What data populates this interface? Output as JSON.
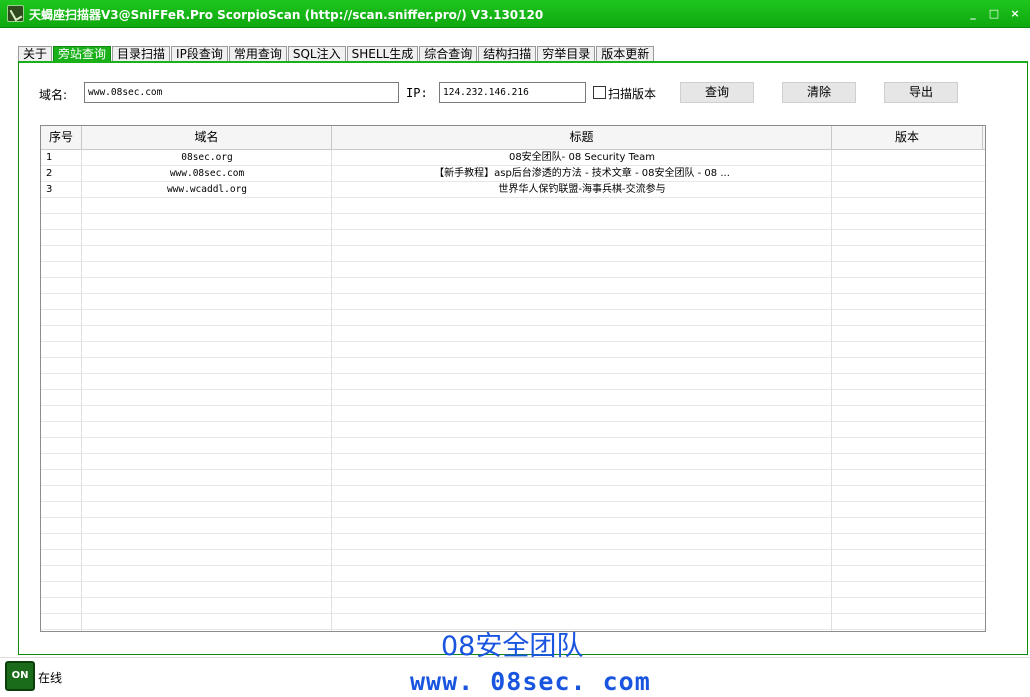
{
  "window": {
    "title": "天蝎座扫描器V3@SniFFeR.Pro  ScorpioScan (http://scan.sniffer.pro/) V3.130120",
    "controls": [
      "_",
      "□",
      "×"
    ]
  },
  "tabs": [
    {
      "label": "关于",
      "active": false
    },
    {
      "label": "旁站查询",
      "active": true
    },
    {
      "label": "目录扫描",
      "active": false
    },
    {
      "label": "IP段查询",
      "active": false
    },
    {
      "label": "常用查询",
      "active": false
    },
    {
      "label": "SQL注入",
      "active": false
    },
    {
      "label": "SHELL生成",
      "active": false
    },
    {
      "label": "综合查询",
      "active": false
    },
    {
      "label": "结构扫描",
      "active": false
    },
    {
      "label": "穷举目录",
      "active": false
    },
    {
      "label": "版本更新",
      "active": false
    }
  ],
  "query": {
    "domain_label": "域名:",
    "domain_value": "www.08sec.com",
    "ip_label": "IP:",
    "ip_value": "124.232.146.216",
    "scan_version_label": "扫描版本",
    "scan_version_checked": false,
    "query_button": "查询",
    "clear_button": "清除",
    "export_button": "导出"
  },
  "table": {
    "columns": [
      "序号",
      "域名",
      "标题",
      "版本"
    ],
    "rows": [
      {
        "index": "1",
        "domain": "08sec.org",
        "title": "08安全团队- 08 Security Team",
        "version": ""
      },
      {
        "index": "2",
        "domain": "www.08sec.com",
        "title": "【新手教程】asp后台渗透的方法 - 技术文章 - 08安全团队 - 08 ...",
        "version": ""
      },
      {
        "index": "3",
        "domain": "www.wcaddl.org",
        "title": "世界华人保钓联盟-海事兵棋-交流参与",
        "version": ""
      }
    ]
  },
  "status": {
    "icon_text": "ON",
    "text": "在线"
  },
  "watermark": {
    "line1": "08安全团队",
    "line2": "www. 08sec. com"
  },
  "colors": {
    "titlebar": "#14b814",
    "active_tab": "#19b019",
    "watermark": "#1a55e0"
  }
}
